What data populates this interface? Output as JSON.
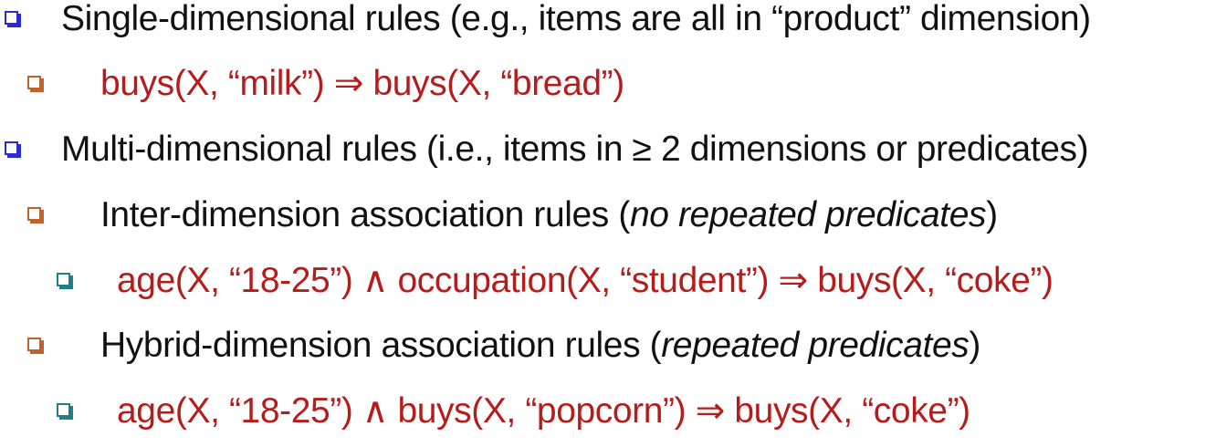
{
  "slide": {
    "colors": {
      "bullet_level1": "#2b2bd4",
      "bullet_level2": "#c4602a",
      "bullet_level3": "#1f7f86",
      "example_text": "#b71c1c",
      "body_text": "#111111"
    },
    "bullets": [
      {
        "id": "single",
        "text": "Single-dimensional rules (e.g., items are all in “product” dimension)"
      },
      {
        "id": "single-example",
        "text": "buys(X, “milk”) ⇒ buys(X, “bread”)"
      },
      {
        "id": "multi",
        "text": "Multi-dimensional rules (i.e., items in ≥ 2 dimensions or predicates)"
      },
      {
        "id": "inter",
        "prefix": "Inter-dimension association rules (",
        "italic": "no repeated predicates",
        "suffix": ")"
      },
      {
        "id": "inter-example",
        "text": "age(X, “18-25”) ∧ occupation(X, “student”) ⇒ buys(X, “coke”)"
      },
      {
        "id": "hybrid",
        "prefix": "Hybrid-dimension association rules (",
        "italic": "repeated predicates",
        "suffix": ")"
      },
      {
        "id": "hybrid-example",
        "text": "age(X, “18-25”) ∧  buys(X, “popcorn”) ⇒ buys(X, “coke”)"
      }
    ]
  }
}
